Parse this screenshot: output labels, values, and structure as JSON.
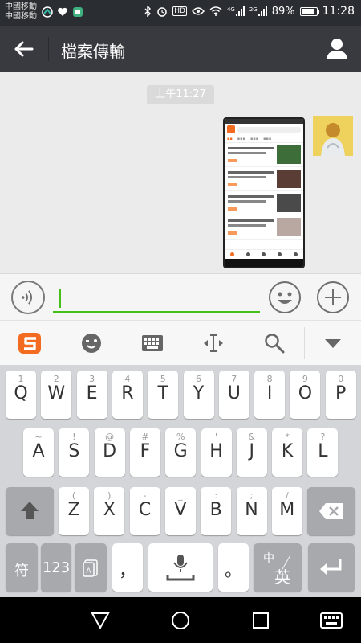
{
  "status_bar": {
    "carrier_1": "中國移動",
    "carrier_2": "中國移動",
    "signal_1": "4G",
    "signal_2": "2G",
    "hd": "HD",
    "battery_pct": "89%",
    "battery_level": 0.89,
    "time": "11:28"
  },
  "header": {
    "title": "檔案傳輸"
  },
  "chat": {
    "timestamp": "上午11:27"
  },
  "input": {
    "value": ""
  },
  "keyboard": {
    "row1": [
      {
        "main": "Q",
        "sub": "1"
      },
      {
        "main": "W",
        "sub": "2"
      },
      {
        "main": "E",
        "sub": "3"
      },
      {
        "main": "R",
        "sub": "4"
      },
      {
        "main": "T",
        "sub": "5"
      },
      {
        "main": "Y",
        "sub": "6"
      },
      {
        "main": "U",
        "sub": "7"
      },
      {
        "main": "I",
        "sub": "8"
      },
      {
        "main": "O",
        "sub": "9"
      },
      {
        "main": "P",
        "sub": "0"
      }
    ],
    "row2": [
      {
        "main": "A",
        "sub": "~"
      },
      {
        "main": "S",
        "sub": "!"
      },
      {
        "main": "D",
        "sub": "@"
      },
      {
        "main": "F",
        "sub": "#"
      },
      {
        "main": "G",
        "sub": "%"
      },
      {
        "main": "H",
        "sub": "'"
      },
      {
        "main": "J",
        "sub": "&"
      },
      {
        "main": "K",
        "sub": "*"
      },
      {
        "main": "L",
        "sub": "?"
      }
    ],
    "row3": [
      {
        "main": "Z",
        "sub": "("
      },
      {
        "main": "X",
        "sub": ")"
      },
      {
        "main": "C",
        "sub": "-"
      },
      {
        "main": "V",
        "sub": "_"
      },
      {
        "main": "B",
        "sub": ":"
      },
      {
        "main": "N",
        "sub": ";"
      },
      {
        "main": "M",
        "sub": "/"
      }
    ],
    "symbol_key": "符",
    "number_key": "123",
    "comma_key": "，",
    "period_key": "。",
    "lang_key_top": "中",
    "lang_key_bottom": "英"
  },
  "colors": {
    "accent": "#45c01a",
    "titlebar": "#393a3f",
    "sogou": "#f36b21"
  }
}
